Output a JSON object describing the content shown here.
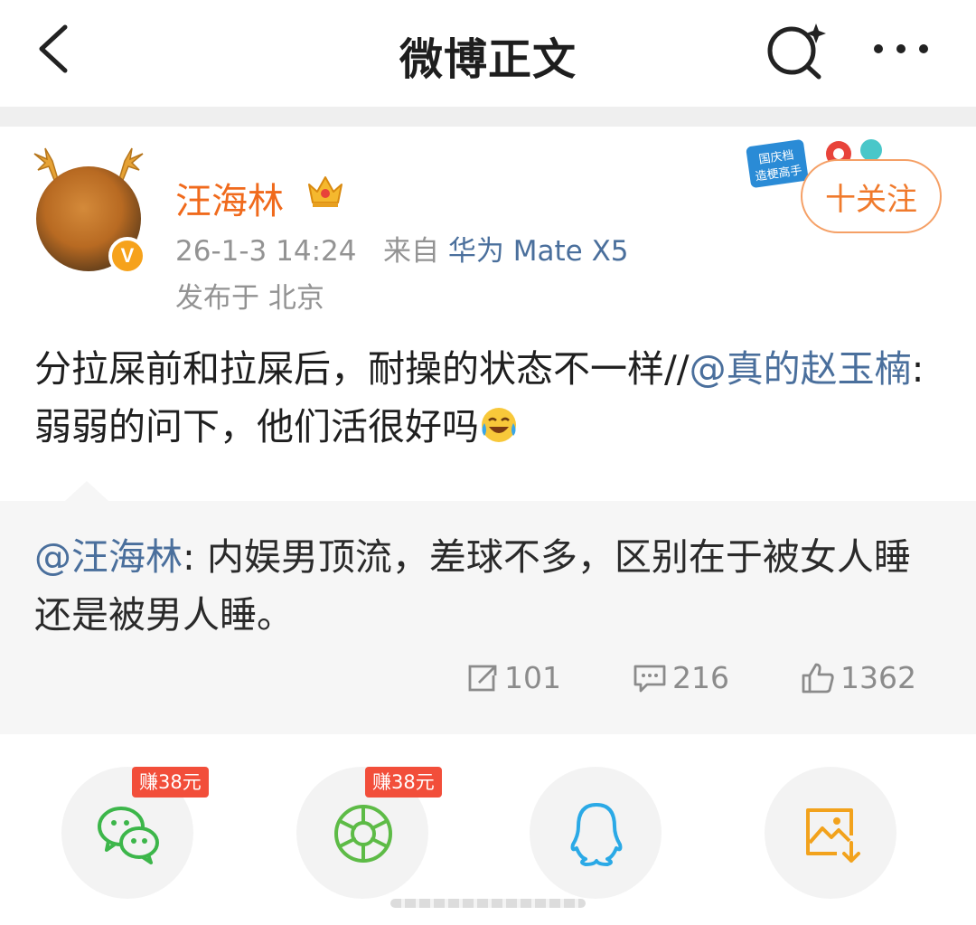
{
  "header": {
    "title": "微博正文"
  },
  "post": {
    "author": "汪海林",
    "time": "26-1-3 14:24",
    "source_prefix": "来自",
    "device": "华为 Mate X5",
    "location": "发布于 北京",
    "follow_label": "十关注",
    "promo_text": "国庆档造梗高手",
    "text_main": "分拉屎前和拉屎后，耐操的状态不一样//",
    "text_mention": "@真的赵玉楠",
    "text_reply": ":弱弱的问下，他们活很好吗"
  },
  "quote": {
    "mention": "@汪海林",
    "text": ": 内娱男顶流，差球不多，区别在于被女人睡还是被男人睡。",
    "reposts": "101",
    "comments": "216",
    "likes": "1362"
  },
  "share": {
    "wechat_reward": "赚38元",
    "moments_reward": "赚38元"
  },
  "colors": {
    "username": "#f06a1c",
    "link": "#4a6f9c",
    "follow": "#f07a2c",
    "reward": "#f24e3a",
    "wechat": "#3cb64a",
    "qq": "#2aa9e6",
    "save": "#f2a21c"
  },
  "icons": [
    "back-icon",
    "search-icon",
    "more-icon",
    "crown-icon",
    "verified-icon",
    "laugh-cry-emoji-icon",
    "repost-icon",
    "comment-icon",
    "like-icon",
    "wechat-icon",
    "moments-icon",
    "qq-icon",
    "save-image-icon"
  ]
}
